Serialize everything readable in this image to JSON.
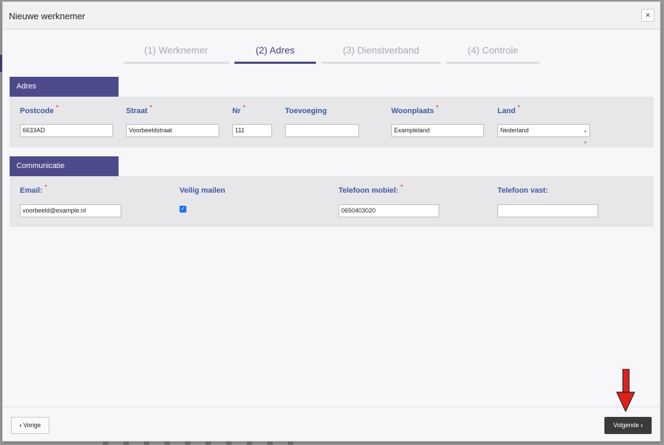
{
  "modal": {
    "title": "Nieuwe werknemer",
    "close_label": "×"
  },
  "steps": [
    {
      "label": "(1) Werknemer",
      "active": false
    },
    {
      "label": "(2) Adres",
      "active": true
    },
    {
      "label": "(3) Dienstverband",
      "active": false
    },
    {
      "label": "(4) Controle",
      "active": false
    }
  ],
  "adres": {
    "section_title": "Adres",
    "postcode": {
      "label": "Postcode",
      "value": "6633AD"
    },
    "straat": {
      "label": "Straat",
      "value": "Voorbeeldstraat"
    },
    "nr": {
      "label": "Nr",
      "value": "111"
    },
    "toevoeging": {
      "label": "Toevoeging",
      "value": ""
    },
    "woonplaats": {
      "label": "Woonplaats",
      "value": "Exampleland"
    },
    "land": {
      "label": "Land",
      "value": "Nederland"
    }
  },
  "communicatie": {
    "section_title": "Communicatie",
    "email": {
      "label": "Email:",
      "value": "voorbeeld@example.nl"
    },
    "veilig_mailen": {
      "label": "Veilig mailen",
      "checked": true
    },
    "telefoon_mobiel": {
      "label": "Telefoon mobiel:",
      "value": "0650403020"
    },
    "telefoon_vast": {
      "label": "Telefoon vast:",
      "value": ""
    }
  },
  "footer": {
    "prev_label": "Vorige",
    "next_label": "Volgende",
    "prev_icon": "chevron-left-icon",
    "next_icon": "chevron-right-icon"
  },
  "colors": {
    "accent": "#45437e",
    "section_header": "#4d4a8c",
    "required": "#e0342e",
    "annotation_arrow": "#e0201b"
  },
  "required_marker": "*"
}
